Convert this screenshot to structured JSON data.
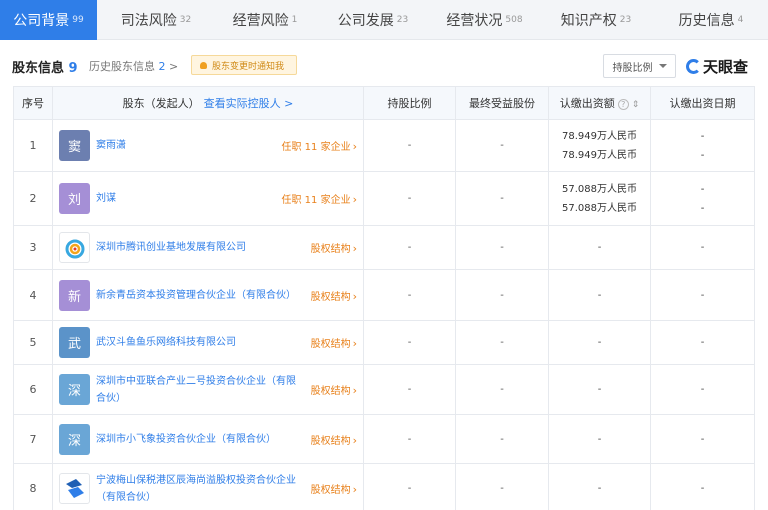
{
  "tabs": [
    {
      "label": "公司背景",
      "count": "99"
    },
    {
      "label": "司法风险",
      "count": "32"
    },
    {
      "label": "经营风险",
      "count": "1"
    },
    {
      "label": "公司发展",
      "count": "23"
    },
    {
      "label": "经营状况",
      "count": "508"
    },
    {
      "label": "知识产权",
      "count": "23"
    },
    {
      "label": "历史信息",
      "count": "4"
    }
  ],
  "section": {
    "title": "股东信息",
    "count": "9",
    "history_label": "历史股东信息",
    "history_count": "2",
    "history_arrow": ">",
    "notice": "股东变更时通知我",
    "ratio_select": "持股比例",
    "logo": "天眼查"
  },
  "columns": {
    "idx": "序号",
    "shareholder": "股东（发起人）",
    "controller_link": "查看实际控股人 >",
    "ratio": "持股比例",
    "final_share": "最终受益股份",
    "subscribed": "认缴出资额",
    "subscribed_date": "认缴出资日期"
  },
  "rows": [
    {
      "idx": "1",
      "avatar": "窦",
      "avatar_color": "#6c7fb0",
      "name": "窦雨潇",
      "action": "任职 11 家企业",
      "ratio": "-",
      "final": "-",
      "amount1": "78.949万人民币",
      "amount2": "78.949万人民币",
      "date1": "-",
      "date2": "-"
    },
    {
      "idx": "2",
      "avatar": "刘",
      "avatar_color": "#a58fd6",
      "name": "刘谋",
      "action": "任职 11 家企业",
      "ratio": "-",
      "final": "-",
      "amount1": "57.088万人民币",
      "amount2": "57.088万人民币",
      "date1": "-",
      "date2": "-"
    },
    {
      "idx": "3",
      "avatar": "",
      "avatar_color": "",
      "name": "深圳市腾讯创业基地发展有限公司",
      "action": "股权结构",
      "ratio": "-",
      "final": "-",
      "amount1": "-",
      "amount2": "",
      "date1": "-",
      "date2": ""
    },
    {
      "idx": "4",
      "avatar": "新",
      "avatar_color": "#a58fd6",
      "name": "新余青岳资本投资管理合伙企业（有限合伙）",
      "action": "股权结构",
      "ratio": "-",
      "final": "-",
      "amount1": "-",
      "amount2": "",
      "date1": "-",
      "date2": ""
    },
    {
      "idx": "5",
      "avatar": "武",
      "avatar_color": "#5b93c9",
      "name": "武汉斗鱼鱼乐网络科技有限公司",
      "action": "股权结构",
      "ratio": "-",
      "final": "-",
      "amount1": "-",
      "amount2": "",
      "date1": "-",
      "date2": ""
    },
    {
      "idx": "6",
      "avatar": "深",
      "avatar_color": "#6aa6d6",
      "name": "深圳市中亚联合产业二号投资合伙企业（有限合伙）",
      "action": "股权结构",
      "ratio": "-",
      "final": "-",
      "amount1": "-",
      "amount2": "",
      "date1": "-",
      "date2": ""
    },
    {
      "idx": "7",
      "avatar": "深",
      "avatar_color": "#6aa6d6",
      "name": "深圳市小飞象投资合伙企业（有限合伙）",
      "action": "股权结构",
      "ratio": "-",
      "final": "-",
      "amount1": "-",
      "amount2": "",
      "date1": "-",
      "date2": ""
    },
    {
      "idx": "8",
      "avatar": "",
      "avatar_color": "",
      "name": "宁波梅山保税港区辰海尚溢股权投资合伙企业（有限合伙）",
      "action": "股权结构",
      "ratio": "-",
      "final": "-",
      "amount1": "-",
      "amount2": "",
      "date1": "-",
      "date2": ""
    }
  ]
}
